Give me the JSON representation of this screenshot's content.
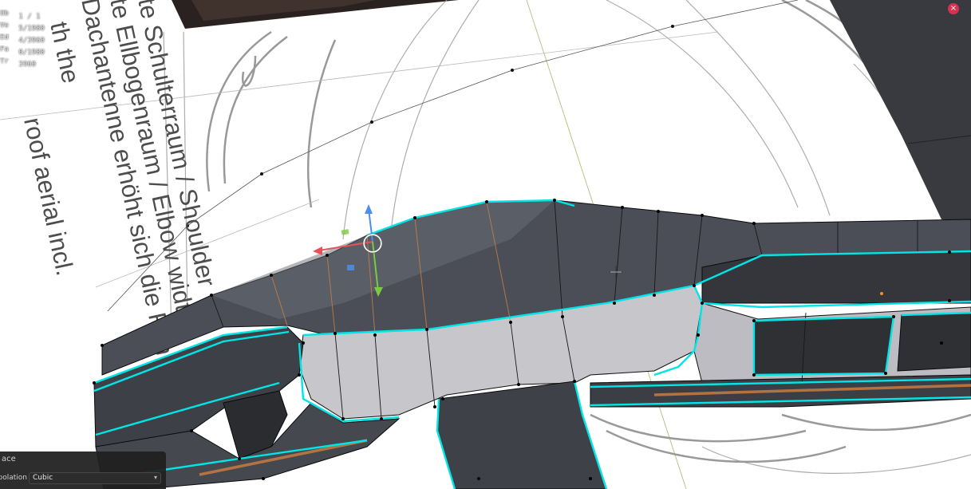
{
  "viewport": {
    "stats": [
      {
        "label": "Ob",
        "value": "1 / 1"
      },
      {
        "label": "Ve",
        "value": "5/1980"
      },
      {
        "label": "Ed",
        "value": "4/3960"
      },
      {
        "label": "Fa",
        "value": "0/1980"
      },
      {
        "label": "Tr",
        "value": "3960"
      }
    ],
    "blueprint_text": [
      "te Schulterraum / Shoulder",
      "te Ellbogenraum / Elbow width",
      "Dachantenne erhöht sich die Fah",
      "th the",
      "roof aerial incl.",
      "w",
      "width"
    ],
    "colors": {
      "wire": "#00e5e5",
      "mesh_dark": "#4a4d55",
      "mesh_light": "#c8c8cc",
      "gizmo_x": "#e4535b",
      "gizmo_y": "#7ac943",
      "gizmo_z": "#4a8ef0",
      "seam": "#c07840"
    }
  },
  "operator_panel": {
    "title": "ace",
    "interpolation_label": "Interpolation",
    "interpolation_value": "Cubic"
  },
  "close_button_label": "×"
}
